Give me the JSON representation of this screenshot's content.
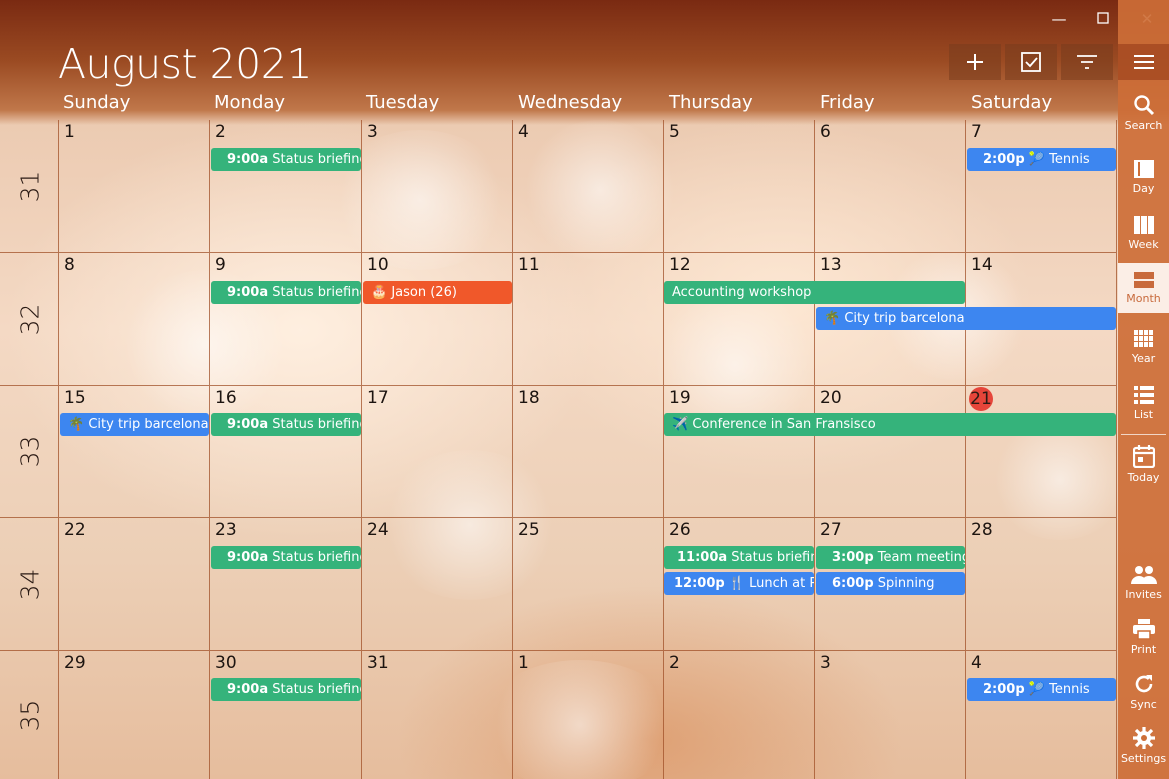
{
  "header": {
    "month_title": "August 2021"
  },
  "toolbar": {
    "add": "+",
    "tasks": "tasks",
    "filter": "filter"
  },
  "days_of_week": [
    "Sunday",
    "Monday",
    "Tuesday",
    "Wednesday",
    "Thursday",
    "Friday",
    "Saturday"
  ],
  "weeks": [
    {
      "number": "31",
      "days": [
        "1",
        "2",
        "3",
        "4",
        "5",
        "6",
        "7"
      ]
    },
    {
      "number": "32",
      "days": [
        "8",
        "9",
        "10",
        "11",
        "12",
        "13",
        "14"
      ]
    },
    {
      "number": "33",
      "days": [
        "15",
        "16",
        "17",
        "18",
        "19",
        "20",
        "21"
      ]
    },
    {
      "number": "34",
      "days": [
        "22",
        "23",
        "24",
        "25",
        "26",
        "27",
        "28"
      ]
    },
    {
      "number": "35",
      "days": [
        "29",
        "30",
        "31",
        "1",
        "2",
        "3",
        "4"
      ]
    }
  ],
  "today": "21",
  "events": {
    "w1_mon": {
      "time": "9:00a",
      "title": "Status briefing"
    },
    "w1_sat": {
      "time": "2:00p",
      "icon": "🎾",
      "title": "Tennis"
    },
    "w2_mon": {
      "time": "9:00a",
      "title": "Status briefing"
    },
    "w2_tue": {
      "icon": "🎂",
      "title": "Jason (26)"
    },
    "w2_thu": {
      "title": "Accounting workshop"
    },
    "w2_fri": {
      "icon": "🌴",
      "title": "City trip barcelona"
    },
    "w3_sun": {
      "icon": "🌴",
      "title": "City trip barcelona"
    },
    "w3_mon": {
      "time": "9:00a",
      "title": "Status briefing"
    },
    "w3_thu": {
      "icon": "✈️",
      "title": "Conference in San Fransisco"
    },
    "w4_mon": {
      "time": "9:00a",
      "title": "Status briefing"
    },
    "w4_thu1": {
      "time": "11:00a",
      "title": "Status briefing"
    },
    "w4_thu2": {
      "time": "12:00p",
      "icon": "🍴",
      "title": "Lunch at Pal"
    },
    "w4_fri1": {
      "time": "3:00p",
      "title": "Team meeting"
    },
    "w4_fri2": {
      "time": "6:00p",
      "title": "Spinning"
    },
    "w5_mon": {
      "time": "9:00a",
      "title": "Status briefing"
    },
    "w5_sat": {
      "time": "2:00p",
      "icon": "🎾",
      "title": "Tennis"
    }
  },
  "sidebar": {
    "search": "Search",
    "day": "Day",
    "week": "Week",
    "month": "Month",
    "year": "Year",
    "list": "List",
    "today": "Today",
    "invites": "Invites",
    "print": "Print",
    "sync": "Sync",
    "settings": "Settings"
  },
  "colors": {
    "green": "#35b37b",
    "blue": "#3d86f0",
    "orange": "#f0582a",
    "today": "#e6453a",
    "sidebar": "#cd6e37"
  }
}
